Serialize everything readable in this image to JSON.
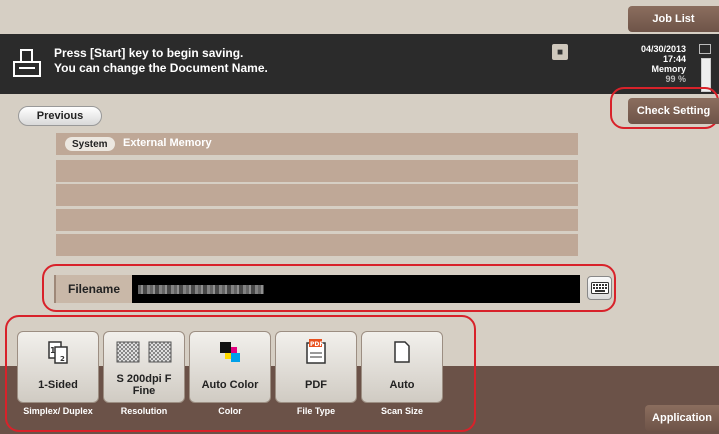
{
  "header": {
    "job_list_label": "Job List",
    "message_line1": "Press [Start] key to begin saving.",
    "message_line2": "You can change the Document Name.",
    "date": "04/30/2013",
    "time": "17:44",
    "memory_label": "Memory",
    "memory_percent": "99 %",
    "memory_level": 0.99,
    "check_setting_label": "Check Setting"
  },
  "navigation": {
    "previous_label": "Previous"
  },
  "path": {
    "badge": "System",
    "location": "External Memory"
  },
  "filename": {
    "label": "Filename",
    "value": ""
  },
  "settings": [
    {
      "value": "1-Sided",
      "caption": "Simplex/ Duplex",
      "icon": "simplex-icon"
    },
    {
      "value": "S 200dpi F Fine",
      "caption": "Resolution",
      "icon": "resolution-icon"
    },
    {
      "value": "Auto Color",
      "caption": "Color",
      "icon": "color-icon"
    },
    {
      "value": "PDF",
      "caption": "File Type",
      "icon": "pdf-icon"
    },
    {
      "value": "Auto",
      "caption": "Scan Size",
      "icon": "page-icon"
    }
  ],
  "footer": {
    "application_label": "Application"
  },
  "colors": {
    "highlight": "#d8222a",
    "tab_brown": "#7a5f52",
    "row_tan": "#bfa897"
  }
}
